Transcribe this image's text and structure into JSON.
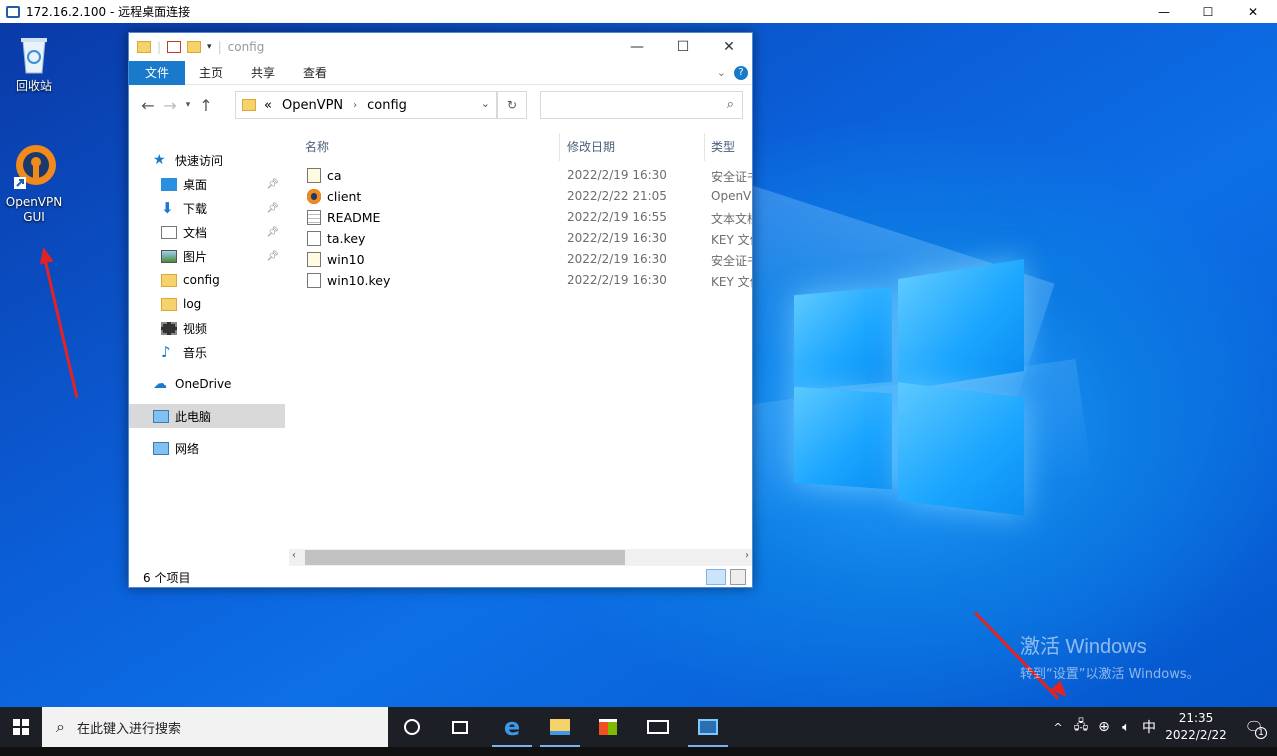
{
  "rdp": {
    "title": "172.16.2.100 - 远程桌面连接",
    "minimize": "—",
    "maximize": "☐",
    "close": "✕"
  },
  "desktop": {
    "icons": [
      {
        "label": "回收站"
      },
      {
        "label_line1": "OpenVPN",
        "label_line2": "GUI"
      }
    ],
    "activate_title": "激活 Windows",
    "activate_sub": "转到“设置”以激活 Windows。"
  },
  "explorer": {
    "title": "config",
    "ribbon": {
      "tabs": [
        "文件",
        "主页",
        "共享",
        "查看"
      ]
    },
    "address": {
      "sep": "«",
      "crumbs": [
        "OpenVPN",
        "config"
      ]
    },
    "nav_items": [
      "快速访问",
      "桌面",
      "下载",
      "文档",
      "图片",
      "config",
      "log",
      "视频",
      "音乐",
      "OneDrive",
      "此电脑",
      "网络"
    ],
    "columns": {
      "name": "名称",
      "date": "修改日期",
      "type": "类型"
    },
    "files": [
      {
        "name": "ca",
        "date": "2022/2/19 16:30",
        "type": "安全证书"
      },
      {
        "name": "client",
        "date": "2022/2/22 21:05",
        "type": "OpenVPN"
      },
      {
        "name": "README",
        "date": "2022/2/19 16:55",
        "type": "文本文档"
      },
      {
        "name": "ta.key",
        "date": "2022/2/19 16:30",
        "type": "KEY 文件"
      },
      {
        "name": "win10",
        "date": "2022/2/19 16:30",
        "type": "安全证书"
      },
      {
        "name": "win10.key",
        "date": "2022/2/19 16:30",
        "type": "KEY 文件"
      }
    ],
    "status": "6 个项目"
  },
  "taskbar": {
    "search_placeholder": "在此键入进行搜索",
    "ime": "中",
    "time": "21:35",
    "date": "2022/2/22",
    "notification_count": "1"
  },
  "colors": {
    "accent": "#1979ca",
    "desktop": "#0b5fd8",
    "taskbar": "#1c2026",
    "arrow": "#e52222"
  }
}
